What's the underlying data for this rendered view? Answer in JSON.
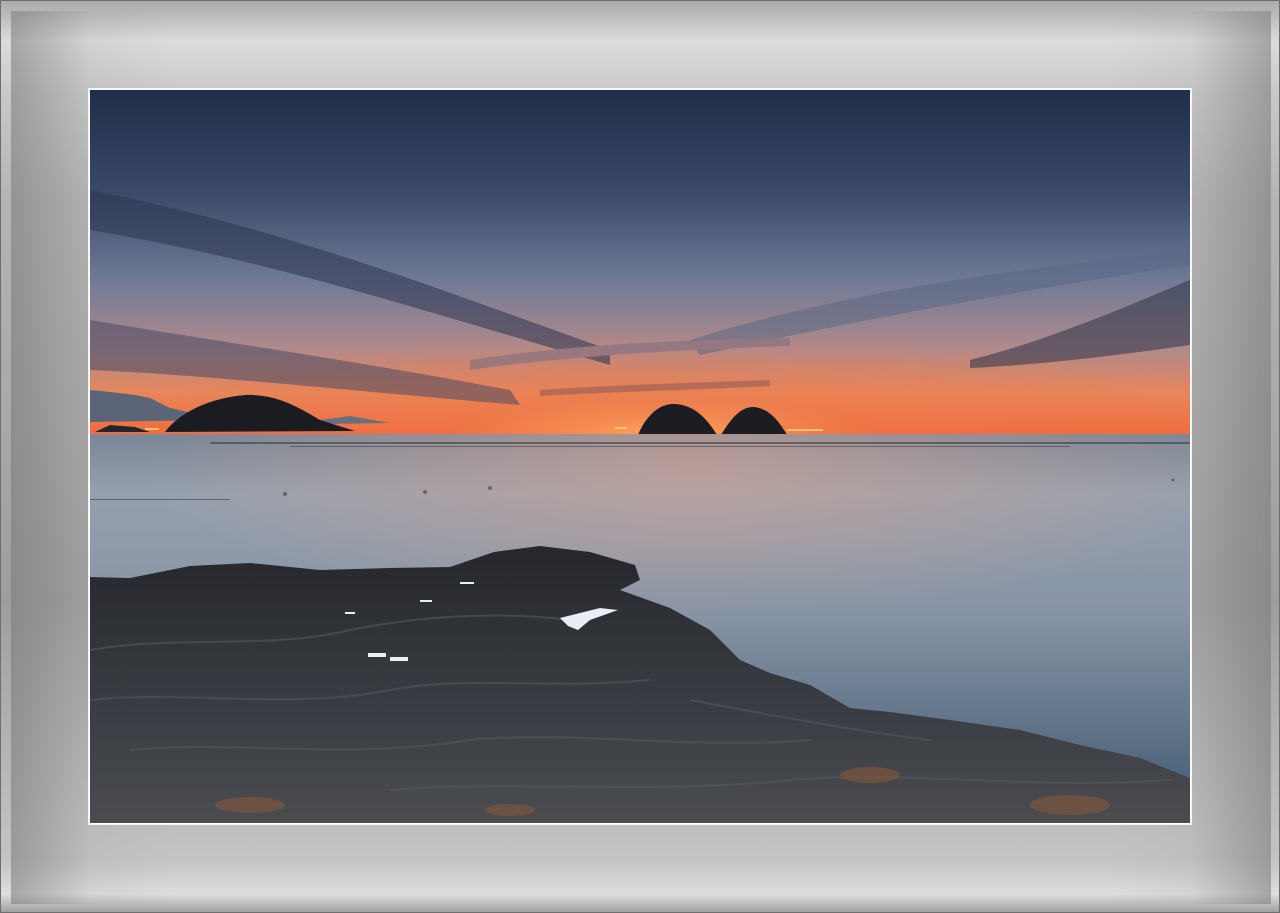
{
  "image": {
    "subject": "coastal-sunset-seascape",
    "colors": {
      "sky_top": "#243450",
      "sky_mid": "#6a7894",
      "horizon_glow": "#f0703c",
      "sea": "#8f9dab",
      "rock": "#2a2c30",
      "frame": "#b8b8b8"
    }
  }
}
